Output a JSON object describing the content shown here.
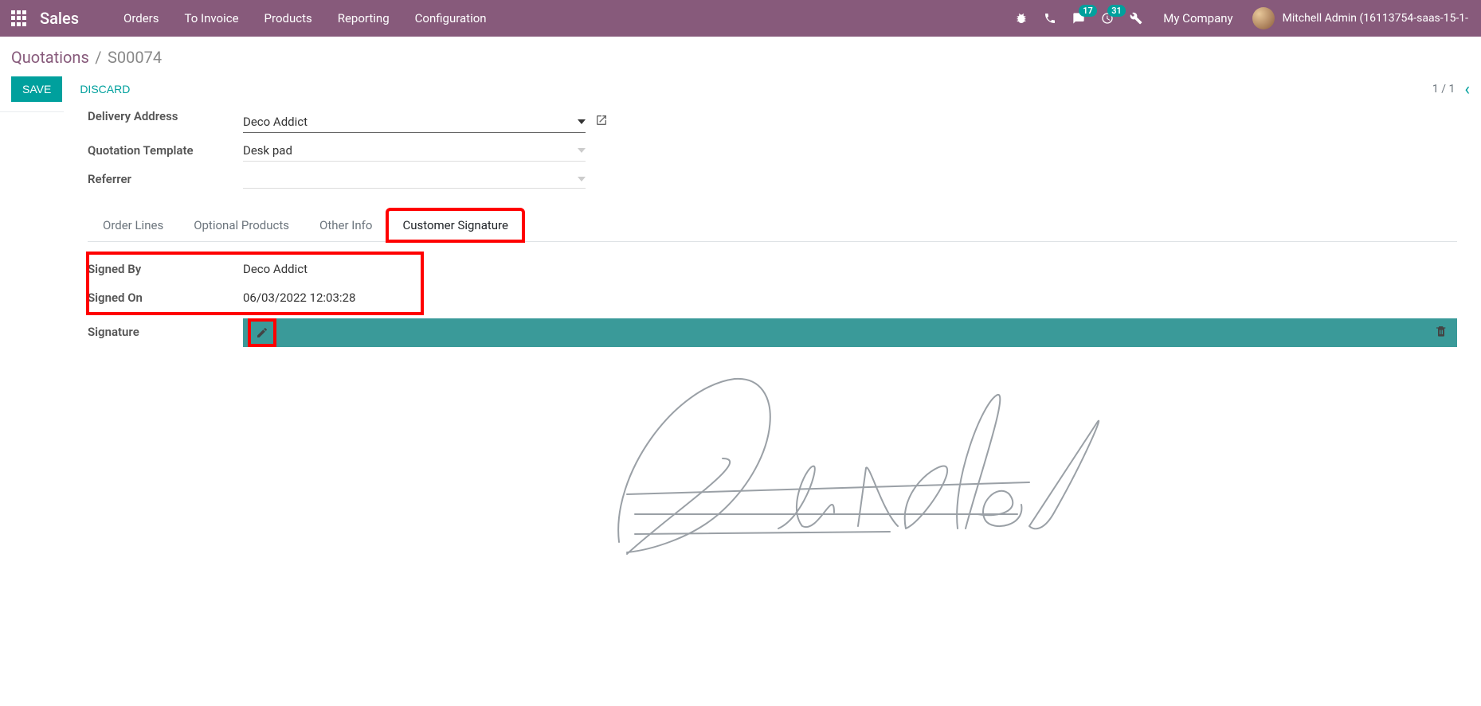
{
  "topnav": {
    "brand": "Sales",
    "menu": [
      "Orders",
      "To Invoice",
      "Products",
      "Reporting",
      "Configuration"
    ],
    "messages_badge": "17",
    "activities_badge": "31",
    "company": "My Company",
    "user": "Mitchell Admin (16113754-saas-15-1-"
  },
  "breadcrumb": {
    "parent": "Quotations",
    "current": "S00074"
  },
  "actions": {
    "save": "SAVE",
    "discard": "DISCARD"
  },
  "pager": {
    "position": "1 / 1"
  },
  "fields": {
    "delivery_address_label": "Delivery Address",
    "delivery_address_value": "Deco Addict",
    "quotation_template_label": "Quotation Template",
    "quotation_template_value": "Desk pad",
    "referrer_label": "Referrer",
    "referrer_value": ""
  },
  "tabs": {
    "order_lines": "Order Lines",
    "optional_products": "Optional Products",
    "other_info": "Other Info",
    "customer_signature": "Customer Signature"
  },
  "signature": {
    "signed_by_label": "Signed By",
    "signed_by_value": "Deco Addict",
    "signed_on_label": "Signed On",
    "signed_on_value": "06/03/2022 12:03:28",
    "signature_label": "Signature"
  }
}
